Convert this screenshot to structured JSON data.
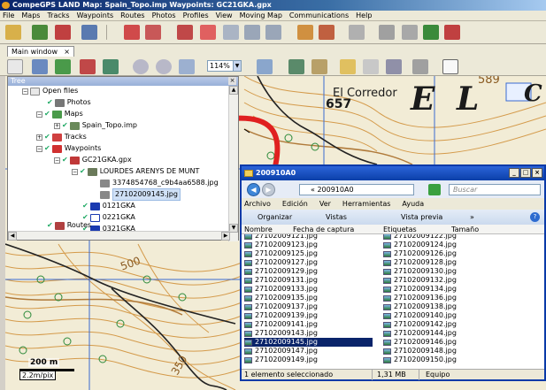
{
  "window": {
    "title": "CompeGPS LAND Map: Spain_Topo.imp Waypoints: GC21GKA.gpx"
  },
  "menu": [
    "File",
    "Maps",
    "Tracks",
    "Waypoints",
    "Routes",
    "Photos",
    "Profiles",
    "View",
    "Moving Map",
    "Communications",
    "Help"
  ],
  "tabs": {
    "main": "Main window",
    "close": "×"
  },
  "toolbar": {
    "zoom_value": "114%"
  },
  "tree": {
    "header": "Tree",
    "close": "×",
    "nodes": [
      {
        "label": "Open files",
        "level": 0
      },
      {
        "label": "Photos",
        "level": 1
      },
      {
        "label": "Maps",
        "level": 1
      },
      {
        "label": "Spain_Topo.imp",
        "level": 2
      },
      {
        "label": "Tracks",
        "level": 1
      },
      {
        "label": "Waypoints",
        "level": 1
      },
      {
        "label": "GC21GKA.gpx",
        "level": 2
      },
      {
        "label": "LOURDES ARENYS DE MUNT",
        "level": 3
      },
      {
        "label": "3374854768_c9b4aa6588.jpg",
        "level": 4
      },
      {
        "label": "27102009145.jpg",
        "level": 4
      },
      {
        "label": "0121GKA",
        "level": 3
      },
      {
        "label": "0221GKA",
        "level": 3
      },
      {
        "label": "0321GKA",
        "level": 3
      },
      {
        "label": "Routes",
        "level": 1
      }
    ]
  },
  "map": {
    "labels": {
      "place1": "El Corredor",
      "elev1": "657",
      "big1": "E",
      "big2": "L",
      "big3": "C",
      "contour1": "589",
      "contour2": "500",
      "contour3": "350"
    },
    "scale_distance": "200 m",
    "scale_resolution": "2.2m/pix"
  },
  "explorer": {
    "title": "200910A0",
    "address": "« 200910A0",
    "search_placeholder": "Buscar",
    "menu": [
      "Archivo",
      "Edición",
      "Ver",
      "Herramientas",
      "Ayuda"
    ],
    "commands": {
      "organize": "Organizar",
      "views": "Vistas",
      "preview": "Vista previa",
      "more": "»"
    },
    "columns": {
      "name": "Nombre",
      "date": "Fecha de captura",
      "tags": "Etiquetas",
      "size": "Tamaño"
    },
    "left_files": [
      "27102009121.jpg",
      "27102009123.jpg",
      "27102009125.jpg",
      "27102009127.jpg",
      "27102009129.jpg",
      "27102009131.jpg",
      "27102009133.jpg",
      "27102009135.jpg",
      "27102009137.jpg",
      "27102009139.jpg",
      "27102009141.jpg",
      "27102009143.jpg",
      "27102009145.jpg",
      "27102009147.jpg",
      "27102009149.jpg"
    ],
    "right_files": [
      "27102009122.jpg",
      "27102009124.jpg",
      "27102009126.jpg",
      "27102009128.jpg",
      "27102009130.jpg",
      "27102009132.jpg",
      "27102009134.jpg",
      "27102009136.jpg",
      "27102009138.jpg",
      "27102009140.jpg",
      "27102009142.jpg",
      "27102009144.jpg",
      "27102009146.jpg",
      "27102009148.jpg",
      "27102009150.jpg"
    ],
    "selected_index": 12,
    "status": {
      "selection": "1 elemento seleccionado",
      "size": "1,31 MB",
      "location": "Equipo"
    }
  },
  "colors": {
    "arrow": "#e02020",
    "selection": "#0a246a"
  }
}
